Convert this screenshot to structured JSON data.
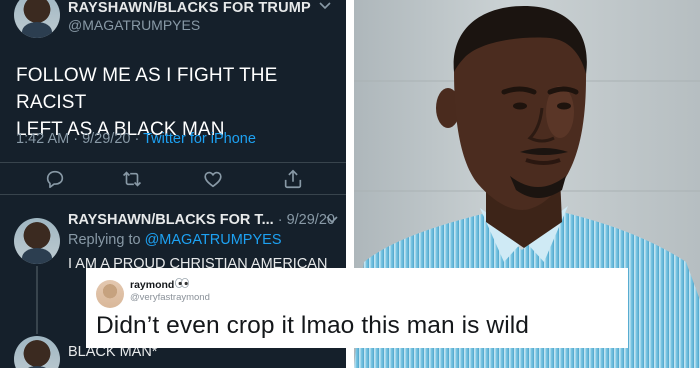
{
  "tweet": {
    "author_name": "RAYSHAWN/BLACKS FOR TRUMP",
    "handle": "@MAGATRUMPYES",
    "text_line1": "FOLLOW ME AS I FIGHT THE RACIST",
    "text_line2": "LEFT AS A BLACK MAN",
    "timestamp": "1:42 AM · 9/29/20 · ",
    "source": "Twitter for iPhone",
    "actions": [
      "reply-icon",
      "retweet-icon",
      "like-icon",
      "share-icon"
    ]
  },
  "reply": {
    "author_name": "RAYSHAWN/BLACKS FOR T...",
    "time": " · 9/29/20",
    "replying_to_prefix": "Replying to ",
    "replying_to_handle": "@MAGATRUMPYES",
    "text": "I AM A PROUD CHRISTIAN AMERICAN",
    "text_2": "BLACK MAN*"
  },
  "overlay": {
    "name": "raymond",
    "handle": "@veryfastraymond",
    "text": "Didn’t even crop it lmao this man is wild"
  },
  "colors": {
    "dark_bg": "#15202b",
    "link_blue": "#1da1f2",
    "muted_text": "#8899a6"
  }
}
